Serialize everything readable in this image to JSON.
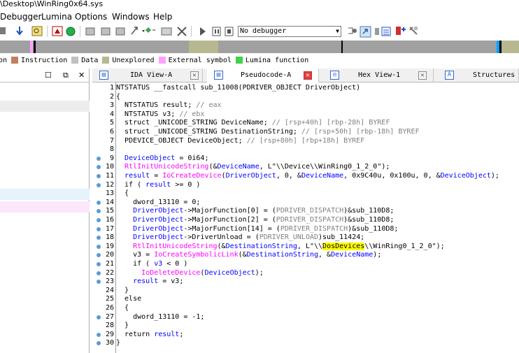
{
  "window": {
    "title": "\\Desktop\\WinRing0x64.sys"
  },
  "menu": [
    "Debugger",
    "Lumina",
    "Options",
    "Windows",
    "Help"
  ],
  "toolbar": {
    "debugger_select": "No debugger"
  },
  "legend": [
    {
      "label": "on",
      "color": "#7f7f7f"
    },
    {
      "label": "Instruction",
      "color": "#c08060"
    },
    {
      "label": "Data",
      "color": "#c0c0c0"
    },
    {
      "label": "Unexplored",
      "color": "#b8b890"
    },
    {
      "label": "External symbol",
      "color": "#ffa0ff"
    },
    {
      "label": "Lumina function",
      "color": "#3cd24a"
    }
  ],
  "tabs": [
    {
      "label": "IDA View-A",
      "icon": "ida-view-icon",
      "active": false
    },
    {
      "label": "Pseudocode-A",
      "icon": "pseudocode-icon",
      "active": true
    },
    {
      "label": "Hex View-1",
      "icon": "hex-view-icon",
      "active": false
    },
    {
      "label": "Structures",
      "icon": "structures-icon",
      "active": false
    }
  ],
  "code": [
    {
      "n": "1",
      "bp": false,
      "parts": [
        [
          "NTSTATUS __fastcall sub_11008(PDRIVER_OBJECT DriverObject)",
          "kw"
        ]
      ]
    },
    {
      "n": "2",
      "bp": false,
      "parts": [
        [
          "{",
          "kw"
        ]
      ]
    },
    {
      "n": "3",
      "bp": false,
      "parts": [
        [
          "  NTSTATUS result; ",
          "kw"
        ],
        [
          "// eax",
          "cmt"
        ]
      ]
    },
    {
      "n": "4",
      "bp": false,
      "parts": [
        [
          "  NTSTATUS v3; ",
          "kw"
        ],
        [
          "// ebx",
          "cmt"
        ]
      ]
    },
    {
      "n": "5",
      "bp": false,
      "parts": [
        [
          "  struct _UNICODE_STRING DeviceName; ",
          "kw"
        ],
        [
          "// [rsp+40h] [rbp-28h] BYREF",
          "cmt"
        ]
      ]
    },
    {
      "n": "6",
      "bp": false,
      "parts": [
        [
          "  struct _UNICODE_STRING DestinationString; ",
          "kw"
        ],
        [
          "// [rsp+50h] [rbp-18h] BYREF",
          "cmt"
        ]
      ]
    },
    {
      "n": "7",
      "bp": false,
      "parts": [
        [
          "  PDEVICE_OBJECT DeviceObject; ",
          "kw"
        ],
        [
          "// [rsp+80h] [rbp+18h] BYREF",
          "cmt"
        ]
      ]
    },
    {
      "n": "8",
      "bp": false,
      "parts": [
        [
          "",
          "kw"
        ]
      ]
    },
    {
      "n": "9",
      "bp": true,
      "parts": [
        [
          "  ",
          "kw"
        ],
        [
          "DeviceObject",
          "var"
        ],
        [
          " = 0i64;",
          "kw"
        ]
      ]
    },
    {
      "n": "10",
      "bp": true,
      "parts": [
        [
          "  ",
          "kw"
        ],
        [
          "RtlInitUnicodeString",
          "call"
        ],
        [
          "(&",
          "kw"
        ],
        [
          "DeviceName",
          "var"
        ],
        [
          ", L\"",
          "kw"
        ],
        [
          "\\\\Device\\\\WinRing0_1_2_0",
          "kw"
        ],
        [
          "\");",
          "kw"
        ]
      ]
    },
    {
      "n": "11",
      "bp": true,
      "parts": [
        [
          "  ",
          "kw"
        ],
        [
          "result",
          "var"
        ],
        [
          " = ",
          "kw"
        ],
        [
          "IoCreateDevice",
          "call"
        ],
        [
          "(",
          "kw"
        ],
        [
          "DriverObject",
          "var"
        ],
        [
          ", 0, &",
          "kw"
        ],
        [
          "DeviceName",
          "var"
        ],
        [
          ", 0x9C40u, 0x100u, 0, &",
          "kw"
        ],
        [
          "DeviceObject",
          "var"
        ],
        [
          ");",
          "kw"
        ]
      ]
    },
    {
      "n": "12",
      "bp": true,
      "parts": [
        [
          "  if ( ",
          "kw"
        ],
        [
          "result",
          "var"
        ],
        [
          " >= 0 )",
          "kw"
        ]
      ]
    },
    {
      "n": "13",
      "bp": false,
      "parts": [
        [
          "  {",
          "kw"
        ]
      ]
    },
    {
      "n": "14",
      "bp": true,
      "parts": [
        [
          "    dword_13110 = 0;",
          "kw"
        ]
      ]
    },
    {
      "n": "15",
      "bp": true,
      "parts": [
        [
          "    ",
          "kw"
        ],
        [
          "DriverObject",
          "var"
        ],
        [
          "->MajorFunction[0] = (",
          "kw"
        ],
        [
          "PDRIVER_DISPATCH",
          "grey"
        ],
        [
          ")&sub_110D8;",
          "kw"
        ]
      ]
    },
    {
      "n": "16",
      "bp": true,
      "parts": [
        [
          "    ",
          "kw"
        ],
        [
          "DriverObject",
          "var"
        ],
        [
          "->MajorFunction[2] = (",
          "kw"
        ],
        [
          "PDRIVER_DISPATCH",
          "grey"
        ],
        [
          ")&sub_110D8;",
          "kw"
        ]
      ]
    },
    {
      "n": "17",
      "bp": true,
      "parts": [
        [
          "    ",
          "kw"
        ],
        [
          "DriverObject",
          "var"
        ],
        [
          "->MajorFunction[14] = (",
          "kw"
        ],
        [
          "PDRIVER_DISPATCH",
          "grey"
        ],
        [
          ")&sub_110D8;",
          "kw"
        ]
      ]
    },
    {
      "n": "18",
      "bp": true,
      "parts": [
        [
          "    ",
          "kw"
        ],
        [
          "DriverObject",
          "var"
        ],
        [
          "->DriverUnload = (",
          "kw"
        ],
        [
          "PDRIVER_UNLOAD",
          "grey"
        ],
        [
          ")sub_11424;",
          "kw"
        ]
      ]
    },
    {
      "n": "19",
      "bp": true,
      "parts": [
        [
          "    ",
          "kw"
        ],
        [
          "RtlInitUnicodeString",
          "call"
        ],
        [
          "(&",
          "kw"
        ],
        [
          "DestinationString",
          "var"
        ],
        [
          ", L\"\\\\",
          "kw"
        ],
        [
          "DosDevices",
          "hl"
        ],
        [
          "\\\\WinRing0_1_2_0\");",
          "kw"
        ]
      ]
    },
    {
      "n": "20",
      "bp": true,
      "parts": [
        [
          "    v3 = ",
          "kw"
        ],
        [
          "IoCreateSymbolicLink",
          "call"
        ],
        [
          "(&",
          "kw"
        ],
        [
          "DestinationString",
          "var"
        ],
        [
          ", &",
          "kw"
        ],
        [
          "DeviceName",
          "var"
        ],
        [
          ");",
          "kw"
        ]
      ]
    },
    {
      "n": "21",
      "bp": true,
      "parts": [
        [
          "    if ( ",
          "kw"
        ],
        [
          "v3",
          "var"
        ],
        [
          " < 0 )",
          "kw"
        ]
      ]
    },
    {
      "n": "22",
      "bp": true,
      "parts": [
        [
          "      ",
          "kw"
        ],
        [
          "IoDeleteDevice",
          "call"
        ],
        [
          "(",
          "kw"
        ],
        [
          "DeviceObject",
          "var"
        ],
        [
          ");",
          "kw"
        ]
      ]
    },
    {
      "n": "23",
      "bp": true,
      "parts": [
        [
          "    ",
          "kw"
        ],
        [
          "result",
          "var"
        ],
        [
          " = v3;",
          "kw"
        ]
      ]
    },
    {
      "n": "24",
      "bp": false,
      "parts": [
        [
          "  }",
          "kw"
        ]
      ]
    },
    {
      "n": "25",
      "bp": false,
      "parts": [
        [
          "  else",
          "kw"
        ]
      ]
    },
    {
      "n": "26",
      "bp": false,
      "parts": [
        [
          "  {",
          "kw"
        ]
      ]
    },
    {
      "n": "27",
      "bp": true,
      "parts": [
        [
          "    dword_13110 = -1;",
          "kw"
        ]
      ]
    },
    {
      "n": "28",
      "bp": false,
      "parts": [
        [
          "  }",
          "kw"
        ]
      ]
    },
    {
      "n": "29",
      "bp": true,
      "parts": [
        [
          "  return ",
          "kw"
        ],
        [
          "result",
          "var"
        ],
        [
          ";",
          "kw"
        ]
      ]
    },
    {
      "n": "30",
      "bp": true,
      "parts": [
        [
          "}",
          "kw"
        ]
      ]
    }
  ]
}
